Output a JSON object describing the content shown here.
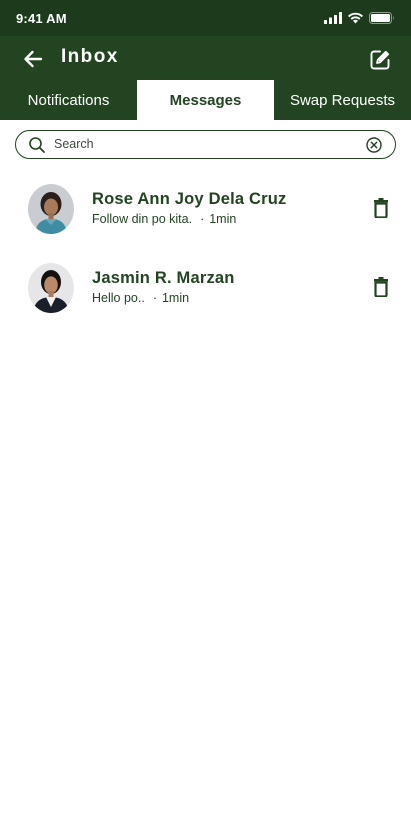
{
  "status_bar": {
    "time": "9:41 AM",
    "icons": [
      "signal-icon",
      "wifi-icon",
      "battery-icon"
    ]
  },
  "header": {
    "title": "Inbox",
    "back_icon": "arrow-left-icon",
    "compose_icon": "edit-square-icon"
  },
  "tabs": [
    {
      "label": "Notifications",
      "active": false
    },
    {
      "label": "Messages",
      "active": true
    },
    {
      "label": "Swap Requests",
      "active": false
    }
  ],
  "search": {
    "placeholder": "Search",
    "value": "",
    "search_icon": "search-icon",
    "clear_icon": "clear-circle-icon"
  },
  "messages": [
    {
      "name": "Rose Ann Joy Dela Cruz",
      "preview": "Follow din po kita.",
      "time": "1min",
      "avatar": "avatar-photo",
      "delete_icon": "trash-icon"
    },
    {
      "name": "Jasmin R. Marzan",
      "preview": "Hello po..",
      "time": "1min",
      "avatar": "avatar-photo",
      "delete_icon": "trash-icon"
    }
  ],
  "colors": {
    "status_bar": "#1d3a1c",
    "header": "#224421",
    "accent_text": "#224421",
    "background": "#ffffff"
  }
}
